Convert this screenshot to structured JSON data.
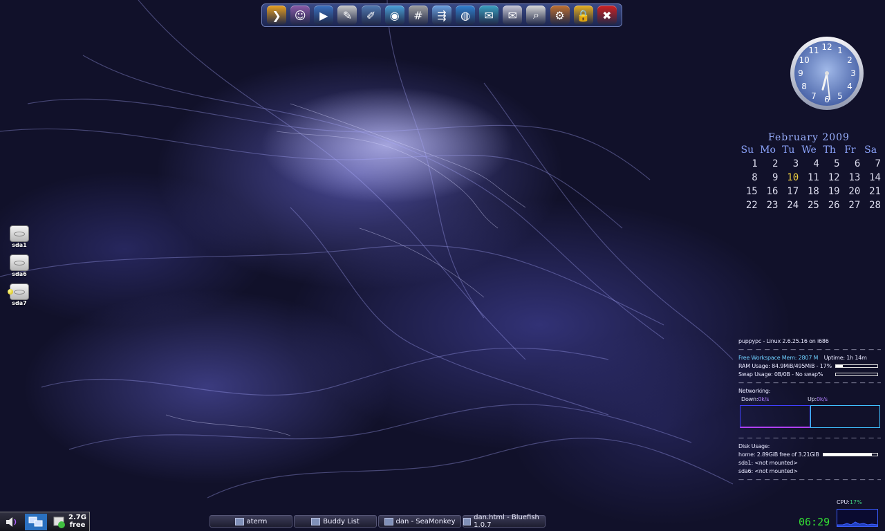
{
  "dock": {
    "items": [
      {
        "icon": "shell-terminal-icon",
        "glyph": "❯",
        "color": "#e8a020"
      },
      {
        "icon": "puppy-icon",
        "glyph": "☺",
        "color": "#8a5aa8"
      },
      {
        "icon": "video-player-icon",
        "glyph": "▶",
        "color": "#3a70c0"
      },
      {
        "icon": "text-editor-icon",
        "glyph": "✎",
        "color": "#c8c8c8"
      },
      {
        "icon": "drawing-icon",
        "glyph": "✐",
        "color": "#5078b0"
      },
      {
        "icon": "disc-burner-icon",
        "glyph": "◉",
        "color": "#4aa0d8"
      },
      {
        "icon": "calculator-icon",
        "glyph": "#",
        "color": "#a0a0a0"
      },
      {
        "icon": "usb-drive-icon",
        "glyph": "⇶",
        "color": "#6aa0e0"
      },
      {
        "icon": "web-browser-icon",
        "glyph": "◍",
        "color": "#3080d0"
      },
      {
        "icon": "network-icon",
        "glyph": "✉",
        "color": "#3aa0c0"
      },
      {
        "icon": "mail-icon",
        "glyph": "✉",
        "color": "#c8c8d8"
      },
      {
        "icon": "search-icon",
        "glyph": "⌕",
        "color": "#d8d8d8"
      },
      {
        "icon": "settings-icon",
        "glyph": "⚙",
        "color": "#c07030"
      },
      {
        "icon": "lock-icon",
        "glyph": "🔒",
        "color": "#e8b020"
      },
      {
        "icon": "shutdown-icon",
        "glyph": "✖",
        "color": "#d02020"
      }
    ]
  },
  "clock": {
    "numerals": [
      "12",
      "1",
      "2",
      "3",
      "4",
      "5",
      "6",
      "7",
      "8",
      "9",
      "10",
      "11"
    ],
    "hour": 6,
    "minute": 29
  },
  "calendar": {
    "title": "February 2009",
    "weekdays": [
      "Su",
      "Mo",
      "Tu",
      "We",
      "Th",
      "Fr",
      "Sa"
    ],
    "weeks": [
      [
        "1",
        "2",
        "3",
        "4",
        "5",
        "6",
        "7"
      ],
      [
        "8",
        "9",
        "10",
        "11",
        "12",
        "13",
        "14"
      ],
      [
        "15",
        "16",
        "17",
        "18",
        "19",
        "20",
        "21"
      ],
      [
        "22",
        "23",
        "24",
        "25",
        "26",
        "27",
        "28"
      ]
    ],
    "today": "10"
  },
  "drives": [
    {
      "label": "sda1",
      "mounted": false
    },
    {
      "label": "sda6",
      "mounted": false
    },
    {
      "label": "sda7",
      "mounted": true
    }
  ],
  "sysmon": {
    "host_line": "puppypc - Linux 2.6.25.16 on i686",
    "free_label": "Free Workspace Mem:",
    "free_value": "2807 M",
    "uptime": "Uptime: 1h 14m",
    "ram": "RAM Usage: 84.9MiB/495MiB - 17%",
    "ram_pct": 17,
    "swap": "Swap Usage: 0B/0B - No swap%",
    "swap_pct": 0,
    "dashes": "— — — — — — — — — — — — — — — — — — — —",
    "net_title": "Networking:",
    "down_label": "Down:",
    "down_value": "0k/s",
    "up_label": "Up:",
    "up_value": "0k/s",
    "disk_title": "Disk Usage:",
    "home": "home: 2.89GiB free of 3.21GiB",
    "home_pct": 90,
    "sda1": "sda1: <not mounted>",
    "sda6": "sda6: <not mounted>"
  },
  "cpu": {
    "label": "CPU:",
    "value": "17%"
  },
  "time": "06:29",
  "tray": {
    "free_size": "2.7G",
    "free_word": "free"
  },
  "taskbar": [
    {
      "label": "aterm"
    },
    {
      "label": "Buddy List"
    },
    {
      "label": "dan - SeaMonkey"
    },
    {
      "label": "dan.html - Bluefish 1.0.7"
    }
  ],
  "colors": {
    "accent": "#6fd0ff",
    "clock_green": "#33e033",
    "today": "#f0d040"
  }
}
